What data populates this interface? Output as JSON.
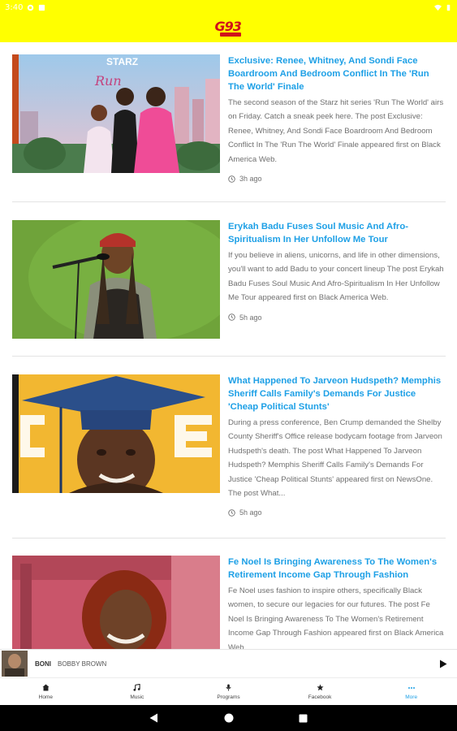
{
  "status_bar": {
    "time": "3:40"
  },
  "app": {
    "logo_text": "G93"
  },
  "articles": [
    {
      "title": "Exclusive: Renee, Whitney, And Sondi Face Boardroom And Bedroom Conflict In The 'Run The World' Finale",
      "excerpt": "The second season of the Starz hit series 'Run The World' airs on Friday. Catch a sneak peek here. The post Exclusive: Renee, Whitney, And Sondi Face Boardroom And Bedroom Conflict In The 'Run The World' Finale appeared first on Black America Web.",
      "time": "3h ago",
      "thumb_text": "STARZ"
    },
    {
      "title": "Erykah Badu Fuses Soul Music And Afro-Spiritualism In Her Unfollow Me Tour",
      "excerpt": "If you believe in aliens, unicorns, and life in other dimensions, you'll want to add Badu to your concert lineup The post Erykah Badu Fuses Soul Music And Afro-Spiritualism In Her Unfollow Me Tour appeared first on Black America Web.",
      "time": "5h ago"
    },
    {
      "title": "What Happened To Jarveon Hudspeth? Memphis Sheriff Calls Family's Demands For Justice 'Cheap Political Stunts'",
      "excerpt": "During a press conference, Ben Crump demanded the Shelby County Sheriff's Office release bodycam footage from Jarveon Hudspeth's death. The post What Happened To Jarveon Hudspeth? Memphis Sheriff Calls Family's Demands For Justice 'Cheap Political Stunts' appeared first on NewsOne. The post What...",
      "time": "5h ago"
    },
    {
      "title": "Fe Noel Is Bringing Awareness To The Women's Retirement Income Gap Through Fashion",
      "excerpt": "Fe Noel uses fashion to inspire others, specifically Black women, to secure our legacies for our futures. The post Fe Noel Is Bringing Awareness To The Women's Retirement Income Gap Through Fashion appeared first on Black America Web.",
      "time": ""
    }
  ],
  "player": {
    "song": "BONI",
    "artist": "BOBBY BROWN",
    "play_icon": "play-icon"
  },
  "bottom_nav": [
    {
      "label": "Home",
      "icon": "home-icon"
    },
    {
      "label": "Music",
      "icon": "music-note-icon"
    },
    {
      "label": "Programs",
      "icon": "microphone-icon"
    },
    {
      "label": "Facebook",
      "icon": "star-icon"
    },
    {
      "label": "More",
      "icon": "more-dots-icon",
      "active": true
    }
  ],
  "colors": {
    "header": "#ffff00",
    "title_link": "#1ea0e6",
    "logo_red": "#d0101b",
    "active_tab": "#1ea0e6"
  }
}
